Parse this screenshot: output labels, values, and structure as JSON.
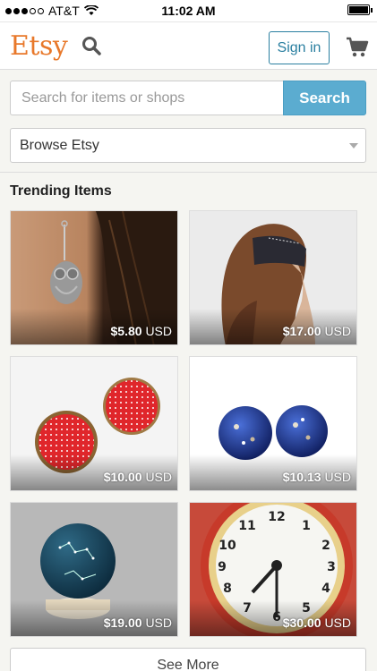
{
  "status": {
    "carrier": "AT&T",
    "time": "11:02 AM"
  },
  "header": {
    "logo": "Etsy",
    "signin_label": "Sign in"
  },
  "search": {
    "placeholder": "Search for items or shops",
    "button_label": "Search"
  },
  "browse": {
    "label": "Browse Etsy"
  },
  "trending": {
    "title": "Trending Items",
    "items": [
      {
        "price": "$5.80",
        "currency": "USD",
        "image": "owl-earring"
      },
      {
        "price": "$17.00",
        "currency": "USD",
        "image": "sleep-mask"
      },
      {
        "price": "$10.00",
        "currency": "USD",
        "image": "red-polka-dot-earrings"
      },
      {
        "price": "$10.13",
        "currency": "USD",
        "image": "blue-glitter-earrings"
      },
      {
        "price": "$19.00",
        "currency": "USD",
        "image": "constellation-globe"
      },
      {
        "price": "$30.00",
        "currency": "USD",
        "image": "alarm-clock"
      }
    ]
  },
  "see_more_label": "See More",
  "colors": {
    "brand": "#e8782a",
    "accent": "#5bacd0",
    "signin": "#2a7fa0"
  }
}
